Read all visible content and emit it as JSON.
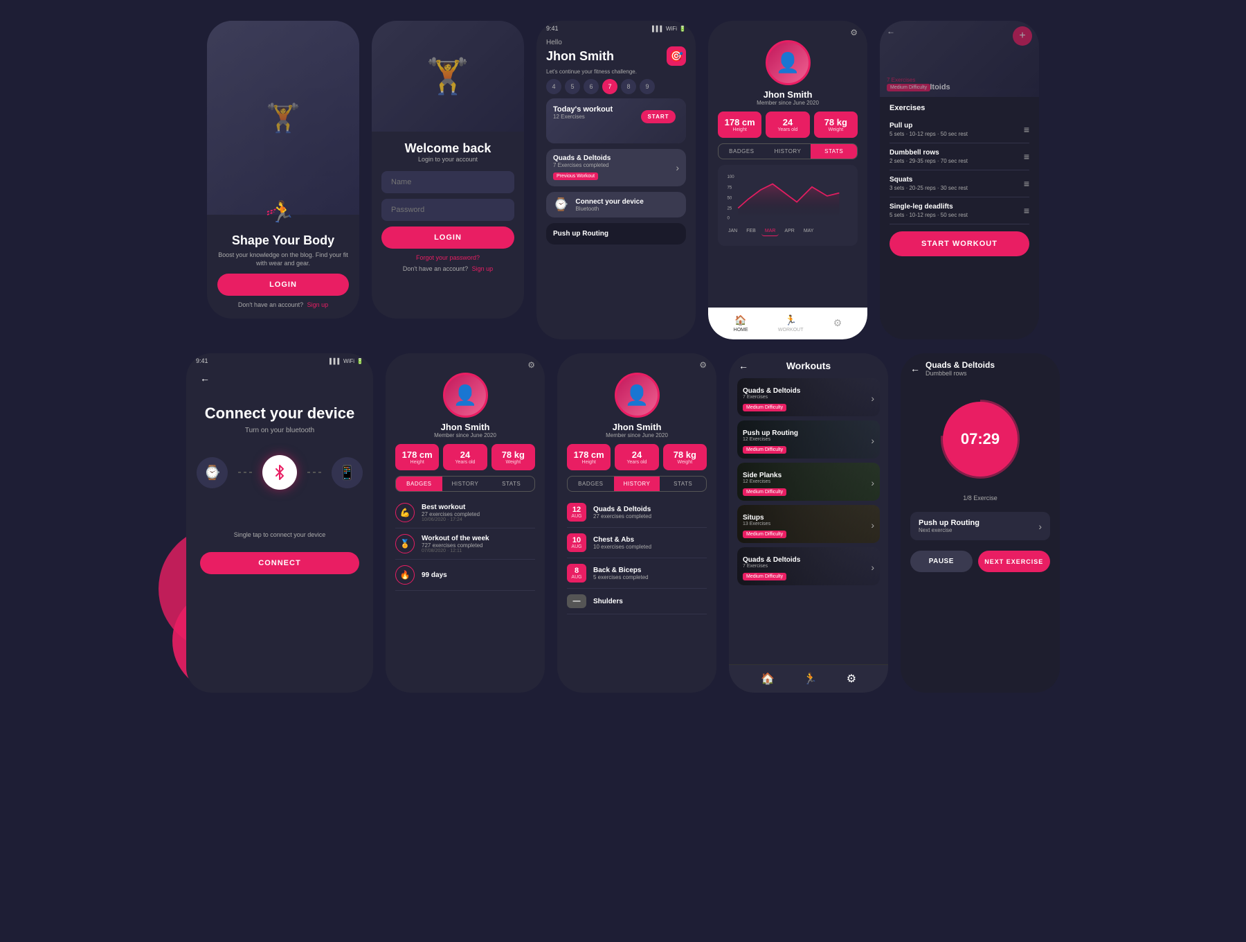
{
  "app": {
    "title": "Fitness App UI",
    "bg_color": "#1e1e35",
    "accent": "#e91e63"
  },
  "screens": {
    "screen1": {
      "title": "Shape Your Body",
      "subtitle": "Boost your knowledge on the blog. Find your fit with wear and gear.",
      "login_btn": "LOGIN",
      "no_account": "Don't have an account?",
      "signup_link": "Sign up"
    },
    "screen2": {
      "title": "Welcome back",
      "subtitle": "Login to your account",
      "name_placeholder": "Name",
      "password_placeholder": "Password",
      "login_btn": "LOGIN",
      "forgot": "Forgot your password?",
      "no_account": "Don't have an account?",
      "signup_link": "Sign up"
    },
    "screen3": {
      "greeting": "Hello",
      "user_name": "Jhon Smith",
      "subtitle": "Let's continue your fitness challenge.",
      "days": [
        "4",
        "5",
        "6",
        "7",
        "8",
        "9"
      ],
      "active_day": "7",
      "workout_title": "Today's workout",
      "workout_count": "12 Exercises",
      "start_btn": "START",
      "prev_workout": "Quads & Deltoids",
      "prev_workout_count": "7 Exercises completed",
      "prev_label": "Previous Workout",
      "connect_title": "Connect your device",
      "connect_subtitle": "Bluetooth",
      "push_up": "Push up Routing"
    },
    "screen4": {
      "user_name": "Jhon Smith",
      "member_since": "Member since June 2020",
      "height": "178 cm",
      "height_label": "Height",
      "age": "24",
      "age_label": "Years old",
      "weight": "78 kg",
      "weight_label": "Weight",
      "tab_badges": "BADGES",
      "tab_history": "HISTORY",
      "tab_stats": "STATS",
      "active_tab": "STATS",
      "chart_max": "100",
      "chart_75": "75",
      "chart_50": "50",
      "chart_25": "25",
      "chart_0": "0",
      "months": [
        "JAN",
        "FEB",
        "MAR",
        "APR",
        "MAY"
      ],
      "active_month": "MAR",
      "nav_home": "HOME",
      "nav_workout": "WORKOUT"
    },
    "screen5": {
      "title": "Quads & Deltoids",
      "difficulty": "Medium Difficulty",
      "exercises_label": "Exercises",
      "add_btn": "+",
      "exercise1_name": "Pull up",
      "exercise1_detail": "5 sets · 10-12 reps · 50 sec rest",
      "exercise2_name": "Dumbbell rows",
      "exercise2_detail": "2 sets · 29-35 reps · 70 sec rest",
      "exercise3_name": "Squats",
      "exercise3_detail": "3 sets · 20-25 reps · 30 sec rest",
      "exercise4_name": "Single-leg deadlifts",
      "exercise4_detail": "5 sets · 10-12 reps · 50 sec rest",
      "start_btn": "START WORKOUT"
    },
    "screen6": {
      "title": "Connect your device",
      "subtitle": "Turn on your bluetooth",
      "bottom_text": "Single tap to connect your device",
      "connect_btn": "CONNECT"
    },
    "screen7": {
      "user_name": "Jhon Smith",
      "member_since": "Member since June 2020",
      "height": "178 cm",
      "height_label": "Height",
      "age": "24",
      "age_label": "Years old",
      "weight": "78 kg",
      "weight_label": "Weight",
      "tab_badges": "BADGES",
      "tab_history": "HISTORY",
      "tab_stats": "STATS",
      "active_tab": "BADGES",
      "item1_title": "Best workout",
      "item1_detail": "27 exercises completed",
      "item1_date": "10/06/2020 · 17:24",
      "item2_title": "Workout of the week",
      "item2_detail": "727 exercises completed",
      "item2_date": "07/08/2020 · 12:11",
      "item3_title": "99 days"
    },
    "screen8": {
      "user_name": "Jhon Smith",
      "member_since": "Member since June 2020",
      "height": "178 cm",
      "height_label": "Height",
      "age": "24",
      "age_label": "Years old",
      "weight": "78 kg",
      "weight_label": "Weight",
      "tab_badges": "BADGES",
      "tab_history": "HISTORY",
      "tab_stats": "STATS",
      "active_tab": "HISTORY",
      "item1_date_num": "12",
      "item1_date_month": "AUG",
      "item1_title": "Quads & Deltoids",
      "item1_detail": "27 exercises completed",
      "item2_date_num": "10",
      "item2_date_month": "AUG",
      "item2_title": "Chest & Abs",
      "item2_detail": "10 exercises completed",
      "item3_date_num": "8",
      "item3_date_month": "AUG",
      "item3_title": "Back & Biceps",
      "item3_detail": "5 exercises completed",
      "item4_title": "Shulders"
    },
    "screen9": {
      "title": "Workouts",
      "item1_title": "Quads & Deltoids",
      "item1_count": "7 Exercises",
      "item1_diff": "Medium Difficulty",
      "item2_title": "Push up Routing",
      "item2_count": "12 Exercises",
      "item2_diff": "Medium Difficulty",
      "item3_title": "Side Planks",
      "item3_count": "12 Exercises",
      "item3_diff": "Medium Difficulty",
      "item4_title": "Situps",
      "item4_count": "13 Exercises",
      "item4_diff": "Medium Difficulty",
      "item5_title": "Quads & Deltoids",
      "item5_count": "7 Exercises",
      "item5_diff": "Medium Difficulty"
    },
    "screen10": {
      "title": "Quads & Deltoids",
      "subtitle": "Dumbbell rows",
      "timer": "07:29",
      "progress": "1/8 Exercise",
      "next_label": "Push up Routing",
      "next_sub": "Next exercise",
      "pause_btn": "PAUSE",
      "next_btn": "NEXT EXERCISE"
    }
  }
}
